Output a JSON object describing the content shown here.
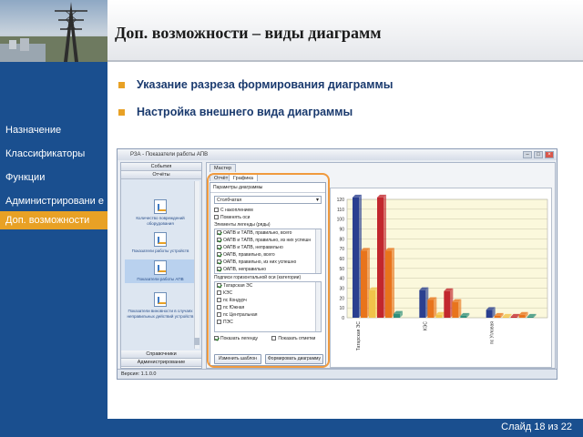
{
  "sidebar": {
    "items": [
      {
        "label": "Назначение"
      },
      {
        "label": "Классификаторы"
      },
      {
        "label": "Функции"
      },
      {
        "label": "Администрировани е"
      },
      {
        "label": "Доп. возможности",
        "active": true
      }
    ],
    "colors": {
      "background": "#1a4f8f",
      "active": "#e8a125"
    }
  },
  "slide": {
    "title": "Доп. возможности – виды диаграмм",
    "bullets": [
      "Указание разреза формирования диаграммы",
      "Настройка внешнего вида диаграммы"
    ],
    "counter": "Слайд 18 из 22"
  },
  "app": {
    "window_title": "РЗА - Показатели работы АПВ",
    "nav": {
      "events_label": "События",
      "reports_label": "Отчёты",
      "reports": [
        "Количество повреждений оборудования",
        "Показатели работы устройств",
        "Показатели работы АПВ",
        "Показатели виновности в случаях неправильных действий устройств"
      ],
      "directories_label": "Справочники",
      "admin_label": "Администрирование"
    },
    "tabs": {
      "outer": "Мастер",
      "report": "Отчёт",
      "chart": "Графика"
    },
    "params": {
      "title": "Параметры диаграммы",
      "chart_type_value": "Столбчатая",
      "accumulate_label": "С накоплением",
      "swap_axes_label": "Поменять оси",
      "legend_items_label": "Элементы легенды (ряды)",
      "legend_items": [
        "ОАПВ и ТАПВ, правильно, всего",
        "ОАПВ и ТАПВ, правильно, из них успешн",
        "ОАПВ и ТАПВ, неправильно",
        "ОАПВ, правильно, всего",
        "ОАПВ, правильно, из них успешно",
        "ОАПВ, неправильно"
      ],
      "x_axis_label": "Подписи горизонтальной оси (категории)",
      "categories_root": "Татарская ЭС",
      "categories": [
        "КЭС",
        "пс Кондурч",
        "пс Южная",
        "пс Центральная",
        "ПЭС"
      ],
      "show_legend_label": "Показать легенду",
      "show_marks_label": "Показать отметки",
      "change_template_label": "Изменить шаблон",
      "build_chart_label": "Формировать диаграмму"
    },
    "version": "Версия: 1.1.0.0"
  },
  "chart_data": {
    "type": "bar",
    "categories": [
      "Татарская ЭС",
      "КЭС",
      "пс Угловая"
    ],
    "series": [
      {
        "color": "#2a3f8f",
        "values": [
          122,
          28,
          8
        ]
      },
      {
        "color": "#e8741c",
        "values": [
          68,
          18,
          2
        ]
      },
      {
        "color": "#f1c34a",
        "values": [
          28,
          3,
          1
        ]
      },
      {
        "color": "#c2272d",
        "values": [
          122,
          27,
          1
        ]
      },
      {
        "color": "#e8741c",
        "values": [
          68,
          16,
          3
        ]
      },
      {
        "color": "#2f8f7a",
        "values": [
          4,
          2,
          1
        ]
      }
    ],
    "ylim": [
      0,
      120
    ],
    "yticks": [
      "0",
      "10",
      "20",
      "30",
      "40",
      "50",
      "60",
      "70",
      "80",
      "90",
      "100",
      "110",
      "120"
    ],
    "grid": true
  }
}
